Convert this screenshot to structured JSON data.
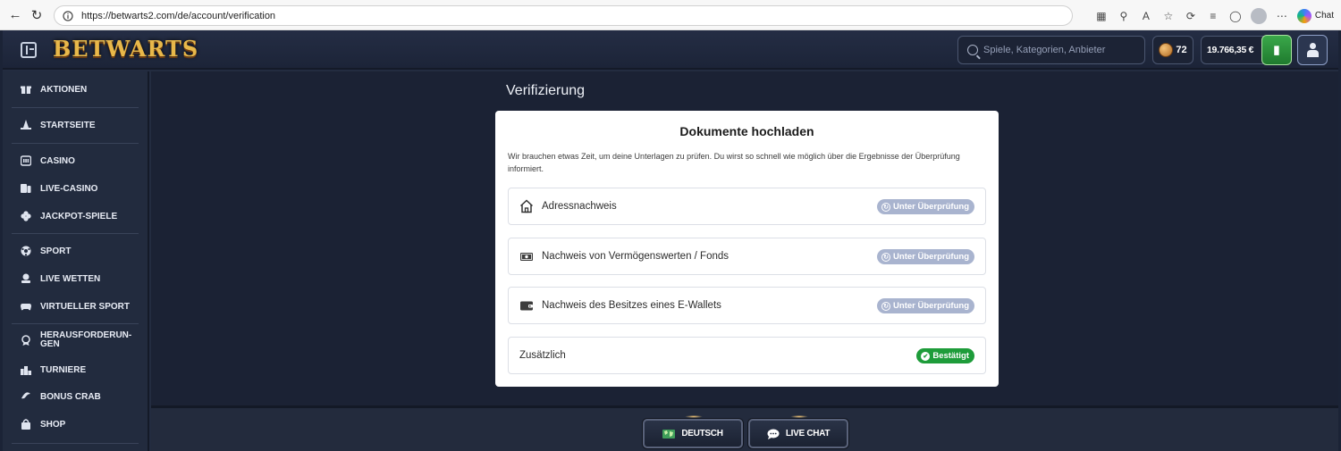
{
  "browser": {
    "url": "https://betwarts2.com/de/account/verification",
    "chat_label": "Chat"
  },
  "header": {
    "brand": "BETWARTS",
    "search_placeholder": "Spiele, Kategorien, Anbieter",
    "coins": "72",
    "balance": "19.766,35 €"
  },
  "sidebar": {
    "items": [
      {
        "label": "AKTIONEN",
        "icon": "gift-icon"
      },
      {
        "label": "STARTSEITE",
        "icon": "witch-hat-icon"
      },
      {
        "label": "CASINO",
        "icon": "casino-icon"
      },
      {
        "label": "LIVE-CASINO",
        "icon": "live-casino-icon"
      },
      {
        "label": "JACKPOT-SPIELE",
        "icon": "clover-icon"
      },
      {
        "label": "SPORT",
        "icon": "soccer-ball-icon"
      },
      {
        "label": "LIVE WETTEN",
        "icon": "live-bet-icon"
      },
      {
        "label": "VIRTUELLER SPORT",
        "icon": "gamepad-icon"
      },
      {
        "label_line1": "HERAUSFORDERUN-",
        "label_line2": "GEN",
        "icon": "medal-icon"
      },
      {
        "label": "TURNIERE",
        "icon": "podium-icon"
      },
      {
        "label": "BONUS CRAB",
        "icon": "crab-icon"
      },
      {
        "label": "SHOP",
        "icon": "shopping-bag-icon"
      }
    ]
  },
  "main": {
    "title": "Verifizierung",
    "card": {
      "title": "Dokumente hochladen",
      "description": "Wir brauchen etwas Zeit, um deine Unterlagen zu prüfen. Du wirst so schnell wie möglich über die Ergebnisse der Überprüfung informiert.",
      "documents": [
        {
          "label": "Adressnachweis",
          "status": "Unter Überprüfung",
          "icon": "house-icon"
        },
        {
          "label": "Nachweis von Vermögenswerten / Fonds",
          "status": "Unter Überprüfung",
          "icon": "cash-icon"
        },
        {
          "label": "Nachweis des Besitzes eines E-Wallets",
          "status": "Unter Überprüfung",
          "icon": "wallet-icon"
        },
        {
          "label": "Zusätzlich",
          "status": "Bestätigt",
          "icon": ""
        }
      ]
    }
  },
  "footer": {
    "language_button": "DEUTSCH",
    "live_chat_button": "LIVE CHAT"
  },
  "colors": {
    "review_badge": "#a9b4cf",
    "confirmed_badge": "#1e9c3a",
    "background": "#1b2234"
  }
}
